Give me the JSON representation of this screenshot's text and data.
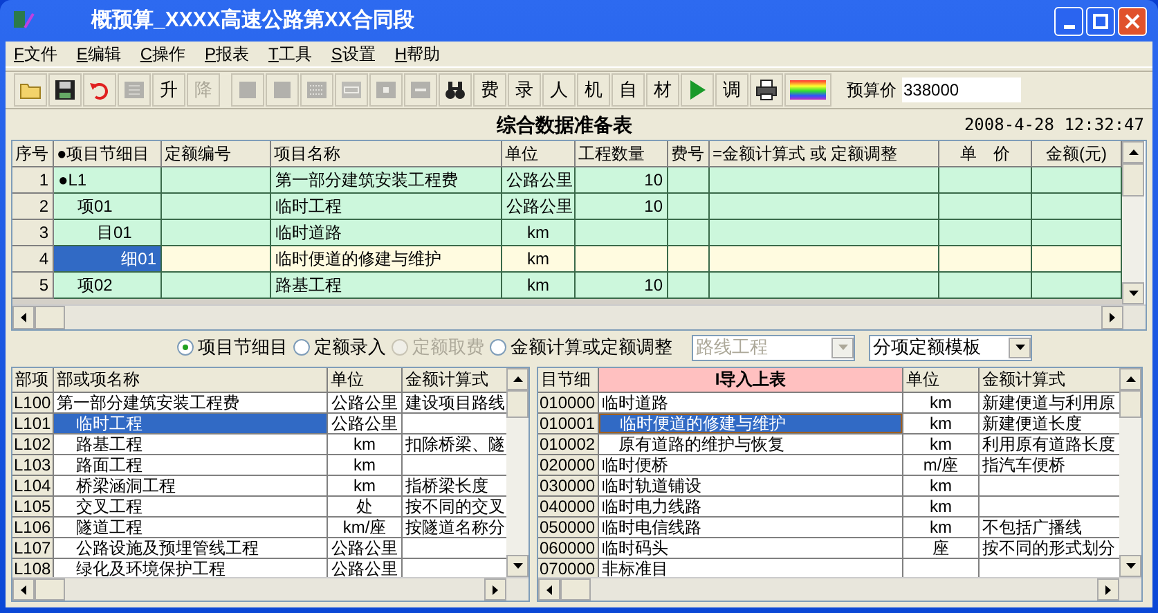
{
  "window": {
    "title": "概预算_XXXX高速公路第XX合同段"
  },
  "menu": [
    "F文件",
    "E编辑",
    "C操作",
    "P报表",
    "T工具",
    "S设置",
    "H帮助"
  ],
  "toolbar": [
    {
      "kind": "icon",
      "disabled": false
    },
    {
      "kind": "icon",
      "disabled": false
    },
    {
      "kind": "icon",
      "disabled": false
    },
    {
      "kind": "icon",
      "disabled": true
    },
    {
      "kind": "text",
      "label": "升",
      "disabled": false
    },
    {
      "kind": "text",
      "label": "降",
      "disabled": true
    },
    {
      "kind": "gap"
    },
    {
      "kind": "icon",
      "disabled": true
    },
    {
      "kind": "icon",
      "disabled": true
    },
    {
      "kind": "icon",
      "disabled": true
    },
    {
      "kind": "icon",
      "disabled": true
    },
    {
      "kind": "icon",
      "disabled": true
    },
    {
      "kind": "icon",
      "disabled": true
    },
    {
      "kind": "icon",
      "disabled": false
    },
    {
      "kind": "text",
      "label": "费",
      "disabled": false
    },
    {
      "kind": "text",
      "label": "录",
      "disabled": false
    },
    {
      "kind": "text",
      "label": "人",
      "disabled": false
    },
    {
      "kind": "text",
      "label": "机",
      "disabled": false
    },
    {
      "kind": "text",
      "label": "自",
      "disabled": false
    },
    {
      "kind": "text",
      "label": "材",
      "disabled": false
    },
    {
      "kind": "icon",
      "disabled": false
    },
    {
      "kind": "text",
      "label": "调",
      "disabled": false
    },
    {
      "kind": "icon",
      "disabled": false
    },
    {
      "kind": "icon",
      "disabled": false
    }
  ],
  "budget": {
    "label": "预算价",
    "value": "338000"
  },
  "heading": "综合数据准备表",
  "datetime": "2008-4-28 12:32:47",
  "main_table": {
    "columns": [
      "序号",
      "●项目节细目",
      "定额编号",
      "项目名称",
      "单位",
      "工程数量",
      "费号",
      "=金额计算式 或 定额调整",
      "单　价",
      "金额(元)"
    ],
    "rows": [
      {
        "no": "1",
        "code": "●L1",
        "name": "第一部分建筑安装工程费",
        "unit": "公路公里",
        "qty": "10",
        "selected": false,
        "children": [
          {
            "no": "2",
            "code": "项01",
            "name": "临时工程",
            "unit": "公路公里",
            "qty": "10",
            "selected": false,
            "children": [
              {
                "no": "3",
                "code": "目01",
                "name": "临时道路",
                "unit": "km",
                "selected": false,
                "children": [
                  {
                    "no": "4",
                    "code": "细01",
                    "name": "临时便道的修建与维护",
                    "unit": "km",
                    "selected": true
                  }
                ]
              }
            ]
          },
          {
            "no": "5",
            "code": "项02",
            "name": "路基工程",
            "unit": "km",
            "qty": "10",
            "selected": false
          }
        ]
      }
    ]
  },
  "modes": [
    {
      "label": "项目节细目",
      "selected": true,
      "disabled": false
    },
    {
      "label": "定额录入",
      "selected": false,
      "disabled": false
    },
    {
      "label": "定额取费",
      "selected": false,
      "disabled": true
    },
    {
      "label": "金额计算或定额调整",
      "selected": false,
      "disabled": false
    }
  ],
  "dropdowns": [
    {
      "value": "路线工程",
      "disabled": true
    },
    {
      "value": "分项定额模板",
      "disabled": false
    }
  ],
  "parts_table": {
    "columns": [
      "部项",
      "部或项名称",
      "单位",
      "金额计算式"
    ],
    "rows": [
      {
        "code": "L100",
        "name": "第一部分建筑安装工程费",
        "unit": "公路公里",
        "formula": "建设项目路线",
        "selected": false,
        "children": [
          {
            "code": "L101",
            "name": "临时工程",
            "unit": "公路公里",
            "selected": true
          },
          {
            "code": "L102",
            "name": "路基工程",
            "unit": "km",
            "formula": "扣除桥梁、隧",
            "selected": false
          },
          {
            "code": "L103",
            "name": "路面工程",
            "unit": "km",
            "selected": false
          },
          {
            "code": "L104",
            "name": "桥梁涵洞工程",
            "unit": "km",
            "formula": "指桥梁长度",
            "selected": false
          },
          {
            "code": "L105",
            "name": "交叉工程",
            "unit": "处",
            "formula": "按不同的交叉",
            "selected": false
          },
          {
            "code": "L106",
            "name": "隧道工程",
            "unit": "km/座",
            "formula": "按隧道名称分",
            "selected": false
          },
          {
            "code": "L107",
            "name": "公路设施及预埋管线工程",
            "unit": "公路公里",
            "selected": false
          },
          {
            "code": "L108",
            "name": "绿化及环境保护工程",
            "unit": "公路公里",
            "selected": false
          }
        ]
      }
    ]
  },
  "items_table": {
    "columns": [
      "目节细",
      "I导入上表",
      "单位",
      "金额计算式"
    ],
    "rows": [
      {
        "code": "010000",
        "name": "临时道路",
        "unit": "km",
        "formula": "新建便道与利用原",
        "selected": false,
        "children": [
          {
            "code": "010001",
            "name": "临时便道的修建与维护",
            "unit": "km",
            "formula": "新建便道长度",
            "selected": true
          },
          {
            "code": "010002",
            "name": "原有道路的维护与恢复",
            "unit": "km",
            "formula": "利用原有道路长度",
            "selected": false
          }
        ]
      },
      {
        "code": "020000",
        "name": "临时便桥",
        "unit": "m/座",
        "formula": "指汽车便桥",
        "selected": false
      },
      {
        "code": "030000",
        "name": "临时轨道铺设",
        "unit": "km",
        "selected": false
      },
      {
        "code": "040000",
        "name": "临时电力线路",
        "unit": "km",
        "selected": false
      },
      {
        "code": "050000",
        "name": "临时电信线路",
        "unit": "km",
        "formula": "不包括广播线",
        "selected": false
      },
      {
        "code": "060000",
        "name": "临时码头",
        "unit": "座",
        "formula": "按不同的形式划分",
        "selected": false
      },
      {
        "code": "070000",
        "name": "非标准目",
        "selected": false
      }
    ]
  }
}
